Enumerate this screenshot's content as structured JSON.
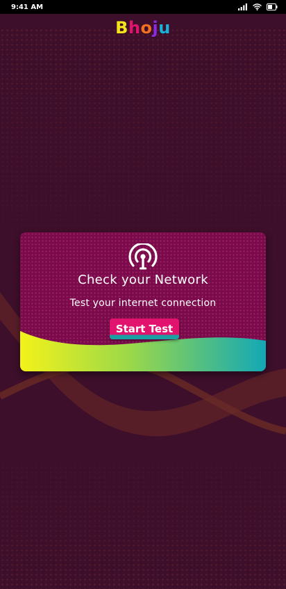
{
  "status_bar": {
    "time": "9:41 AM"
  },
  "logo": {
    "letters": [
      "B",
      "h",
      "o",
      "j",
      "u"
    ],
    "colors": [
      "#f7e41b",
      "#e2136e",
      "#f36f21",
      "#8a2be2",
      "#1ab0d8"
    ]
  },
  "card": {
    "icon": "network-broadcast-icon",
    "title": "Check your Network",
    "subtitle": "Test your internet connection",
    "button_label": "Start Test"
  },
  "colors": {
    "background": "#3d0f2a",
    "card": "#7a0a4b",
    "accent_pink": "#e2136e",
    "accent_teal": "#1a9fa3",
    "wave_yellow": "#e8ef10"
  }
}
